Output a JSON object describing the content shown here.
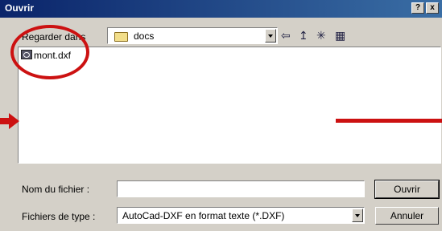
{
  "window": {
    "title": "Ouvrir",
    "help_label": "?",
    "close_label": "x"
  },
  "lookin": {
    "label": "Regarder dans",
    "value": "docs"
  },
  "toolbar": {
    "back_icon": "⇦",
    "up_icon": "↥",
    "newfolder_icon": "✳",
    "views_icon": "▦"
  },
  "files": [
    {
      "name": "mont.dxf"
    }
  ],
  "filename": {
    "label": "Nom du fichier :",
    "value": ""
  },
  "filetype": {
    "label": "Fichiers de type :",
    "value": "AutoCad-DXF en format texte   (*.DXF)"
  },
  "buttons": {
    "open": "Ouvrir",
    "cancel": "Annuler"
  },
  "colors": {
    "annotation": "#cc1111",
    "titlebar": "#0a246a"
  }
}
